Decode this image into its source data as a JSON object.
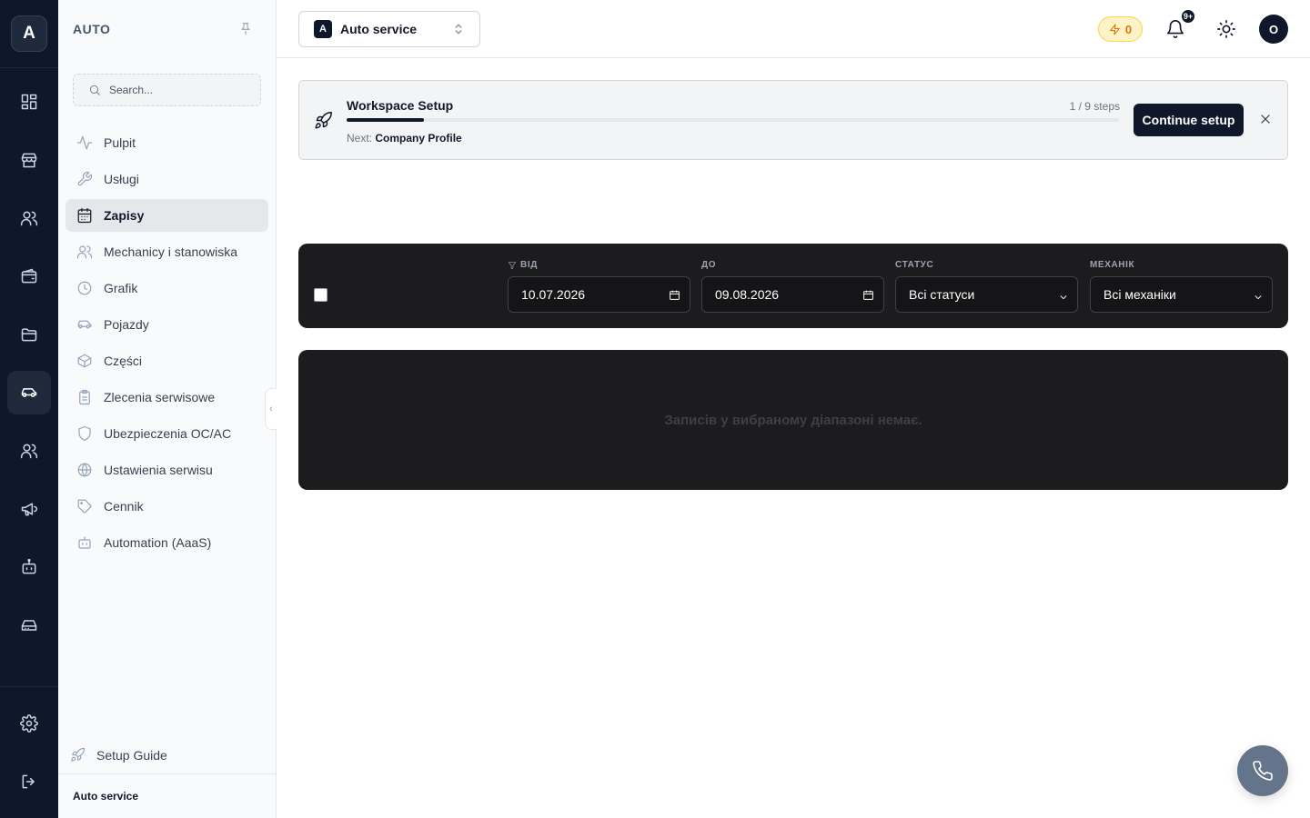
{
  "rail": {
    "logo_letter": "A",
    "items": [
      {
        "icon": "dashboard-icon"
      },
      {
        "icon": "store-icon"
      },
      {
        "icon": "users-icon"
      },
      {
        "icon": "wallet-icon"
      },
      {
        "icon": "folder-icon"
      },
      {
        "icon": "car-icon",
        "active": true
      },
      {
        "icon": "team-icon"
      },
      {
        "icon": "megaphone-icon"
      },
      {
        "icon": "bot-icon"
      },
      {
        "icon": "drive-icon"
      }
    ],
    "bottom": [
      {
        "icon": "gear-icon"
      },
      {
        "icon": "logout-icon"
      }
    ]
  },
  "sidebar": {
    "title": "AUTO",
    "search_placeholder": "Search...",
    "items": [
      {
        "label": "Pulpit",
        "icon": "activity-icon"
      },
      {
        "label": "Usługi",
        "icon": "wrench-icon"
      },
      {
        "label": "Zapisy",
        "icon": "calendar-icon",
        "active": true
      },
      {
        "label": "Mechanicy i stanowiska",
        "icon": "users-icon"
      },
      {
        "label": "Grafik",
        "icon": "clock-icon"
      },
      {
        "label": "Pojazdy",
        "icon": "car-icon"
      },
      {
        "label": "Części",
        "icon": "box-icon"
      },
      {
        "label": "Zlecenia serwisowe",
        "icon": "clipboard-icon"
      },
      {
        "label": "Ubezpieczenia OC/AC",
        "icon": "shield-icon"
      },
      {
        "label": "Ustawienia serwisu",
        "icon": "globe-icon"
      },
      {
        "label": "Cennik",
        "icon": "tag-icon"
      },
      {
        "label": "Automation (AaaS)",
        "icon": "bot-icon"
      }
    ],
    "setup_guide": "Setup Guide",
    "footer": "Auto service"
  },
  "header": {
    "workspace_badge": "A",
    "workspace_name": "Auto service",
    "credits": "0",
    "notifications_badge": "9+",
    "avatar": "O"
  },
  "banner": {
    "title": "Workspace Setup",
    "steps": "1 / 9 steps",
    "progress": 0.1,
    "next_label": "Next:",
    "next_value": "Company Profile",
    "button": "Continue setup"
  },
  "filters": {
    "from_label": "ВІД",
    "from_value": "10.07.2026",
    "to_label": "ДО",
    "to_value": "09.08.2026",
    "status_label": "СТАТУС",
    "status_value": "Всі статуси",
    "mechanic_label": "МЕХАНІК",
    "mechanic_value": "Всі механіки"
  },
  "empty": {
    "message": "Записів у вибраному діапазоні немає."
  },
  "colors": {
    "rail_bg": "#0f172a",
    "accent": "#0f172a",
    "panel_dark": "#1c1c1e",
    "credits_bg": "#fef3c7",
    "credits_fg": "#d97706"
  }
}
